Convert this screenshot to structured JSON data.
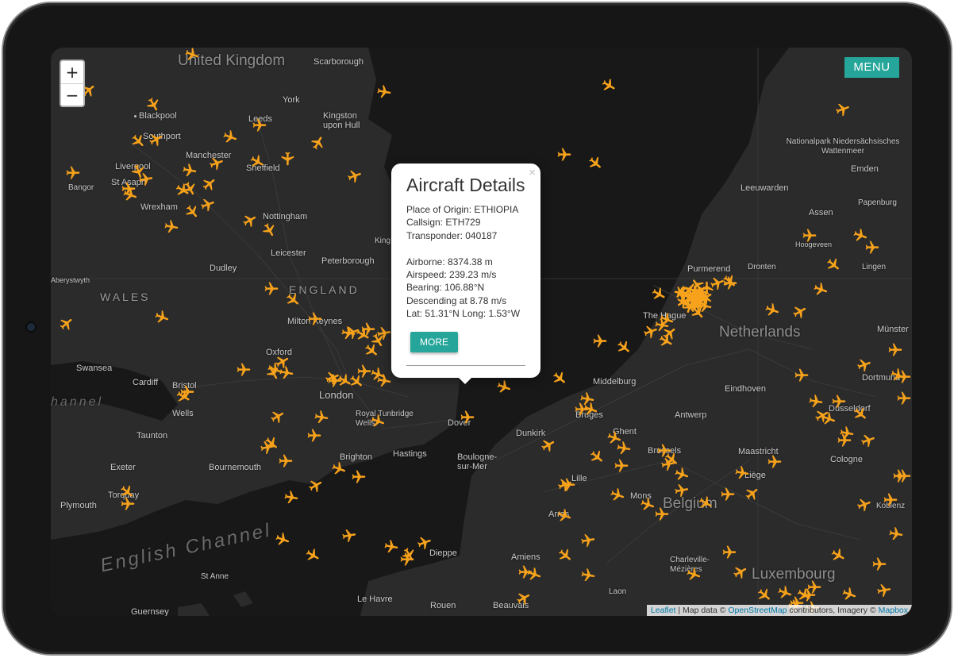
{
  "controls": {
    "zoom_in": "+",
    "zoom_out": "−",
    "menu": "MENU"
  },
  "popup": {
    "title": "Aircraft Details",
    "close": "×",
    "origin": "Place of Origin: ETHIOPIA",
    "callsign": "Callsign: ETH729",
    "transponder": "Transponder: 040187",
    "airborne": "Airborne: 8374.38 m",
    "airspeed": "Airspeed: 239.23 m/s",
    "bearing": "Bearing: 106.88°N",
    "descending": "Descending at 8.78 m/s",
    "latlong": "Lat: 51.31°N Long: 1.53°W",
    "more": "MORE"
  },
  "attribution": {
    "leaflet": "Leaflet",
    "sep": " | Map data © ",
    "osm": "OpenStreetMap",
    "mid": " contributors, Imagery © ",
    "mapbox": "Mapbox"
  },
  "map_labels": {
    "united_kingdom": "United Kingdom",
    "england": "ENGLAND",
    "wales": "WALES",
    "netherlands": "Netherlands",
    "belgium": "Belgium",
    "luxembourg": "Luxembourg",
    "english_channel": "English Channel",
    "channel": "hannel",
    "scarborough": "Scarborough",
    "york": "York",
    "blackpool": "Blackpool",
    "southport": "Southport",
    "leeds": "Leeds",
    "kingston": "Kingston upon Hull",
    "manchester": "Manchester",
    "liverpool": "Liverpool",
    "sheffield": "Sheffield",
    "bangor": "Bangor",
    "st_asaph": "St Asaph",
    "wrexham": "Wrexham",
    "nottingham": "Nottingham",
    "leicester": "Leicester",
    "peterborough": "Peterborough",
    "kings": "King",
    "dudley": "Dudley",
    "aberystwyth": "Aberystwyth",
    "milton_keynes": "Milton Keynes",
    "oxford": "Oxford",
    "swansea": "Swansea",
    "cardiff": "Cardiff",
    "bristol": "Bristol",
    "london": "London",
    "wells": "Wells",
    "royal_tunbridge": "Royal Tunbridge Wells",
    "dover": "Dover",
    "taunton": "Taunton",
    "brighton": "Brighton",
    "hastings": "Hastings",
    "exeter": "Exeter",
    "bournemouth": "Bournemouth",
    "torquay": "Torquay",
    "plymouth": "Plymouth",
    "st_anne": "St Anne",
    "guernsey": "Guernsey",
    "boulogne": "Boulogne-sur-Mer",
    "dunkirk": "Dunkirk",
    "dieppe": "Dieppe",
    "amiens": "Amiens",
    "le_havre": "Le Havre",
    "rouen": "Rouen",
    "beauvais": "Beauvais",
    "lille": "Lille",
    "arras": "Arras",
    "mons": "Mons",
    "bruges": "Bruges",
    "ghent": "Ghent",
    "antwerp": "Antwerp",
    "brussels": "Brussels",
    "liege": "Liège",
    "maastricht": "Maastricht",
    "eindhoven": "Eindhoven",
    "middelburg": "Middelburg",
    "the_hague": "The Hague",
    "purmerend": "Purmerend",
    "dronten": "Dronten",
    "leeuwarden": "Leeuwarden",
    "assen": "Assen",
    "emden": "Emden",
    "papenburg": "Papenburg",
    "hoogeveen": "Hoogeveen",
    "lingen": "Lingen",
    "munster": "Münster",
    "dortmund": "Dortmund",
    "dusseldorf": "Düsseldorf",
    "cologne": "Cologne",
    "koblenz": "Koblenz",
    "charleville": "Charleville-Mézières",
    "laon": "Laon",
    "nationalpark": "Nationalpark Niedersächsisches Wattenmeer"
  },
  "colors": {
    "plane": "#f7a21b",
    "accent": "#26a69a",
    "map_background": "#262626"
  }
}
